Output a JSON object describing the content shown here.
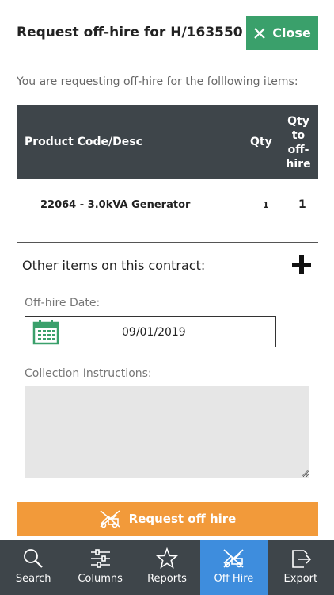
{
  "header": {
    "title": "Request off-hire for H/163550",
    "close_label": "Close"
  },
  "intro": "You are requesting off-hire for the folllowing items:",
  "table": {
    "columns": [
      "Product Code/Desc",
      "Qty",
      "Qty to off-hire"
    ],
    "qty_off_lines": [
      "Qty",
      "to",
      "off-",
      "hire"
    ],
    "rows": [
      {
        "desc": "22064 - 3.0kVA Generator",
        "qty": "1",
        "qty_off": "1"
      }
    ]
  },
  "other_items": {
    "label": "Other items on this contract:",
    "icon": "plus-icon"
  },
  "offhire_date": {
    "label": "Off-hire Date:",
    "value": "09/01/2019",
    "icon": "calendar-icon"
  },
  "collection": {
    "label": "Collection Instructions:",
    "value": ""
  },
  "request_button": {
    "label": "Request off hire",
    "icon": "off-hire-icon"
  },
  "tabs": [
    {
      "label": "Search",
      "icon": "search-icon"
    },
    {
      "label": "Columns",
      "icon": "sliders-icon"
    },
    {
      "label": "Reports",
      "icon": "star-icon"
    },
    {
      "label": "Off Hire",
      "icon": "off-hire-icon",
      "active": true
    },
    {
      "label": "Export",
      "icon": "export-icon"
    }
  ],
  "colors": {
    "green": "#3aa06b",
    "orange": "#f29a3a",
    "dark": "#3e454a",
    "active_tab": "#3e8ddd"
  }
}
